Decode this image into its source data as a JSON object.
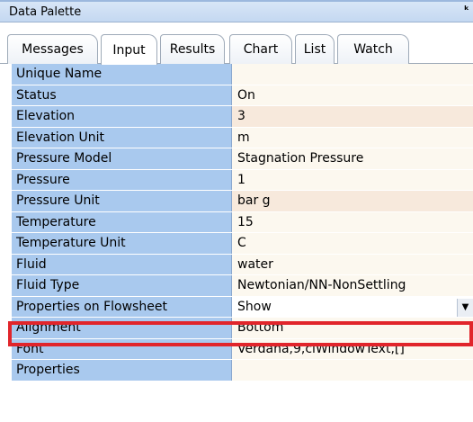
{
  "panel": {
    "title": "Data Palette",
    "pin_icon": "pin-icon"
  },
  "tabs": [
    {
      "label": "Messages",
      "active": false
    },
    {
      "label": "Input",
      "active": true
    },
    {
      "label": "Results",
      "active": false
    },
    {
      "label": "Chart",
      "active": false
    },
    {
      "label": "List",
      "active": false
    },
    {
      "label": "Watch",
      "active": false
    }
  ],
  "properties": [
    {
      "name": "Unique Name",
      "value": ""
    },
    {
      "name": "Status",
      "value": "On"
    },
    {
      "name": "Elevation",
      "value": "3"
    },
    {
      "name": "Elevation Unit",
      "value": "m"
    },
    {
      "name": "Pressure Model",
      "value": "Stagnation Pressure"
    },
    {
      "name": "Pressure",
      "value": "1"
    },
    {
      "name": "Pressure Unit",
      "value": "bar g"
    },
    {
      "name": "Temperature",
      "value": "15"
    },
    {
      "name": "Temperature Unit",
      "value": "C"
    },
    {
      "name": "Fluid",
      "value": "water"
    },
    {
      "name": "Fluid Type",
      "value": "Newtonian/NN-NonSettling"
    },
    {
      "name": "Properties on Flowsheet",
      "value": "Show",
      "dropdown": true
    },
    {
      "name": "Alignment",
      "value": "Bottom"
    },
    {
      "name": "Font",
      "value": "Verdana,9,clWindowText,[]"
    },
    {
      "name": "Properties",
      "value": ""
    }
  ],
  "colors": {
    "highlight": "#e1252b",
    "name_cell": "#a9c9ee",
    "value_alt": "#f7e9dc"
  }
}
